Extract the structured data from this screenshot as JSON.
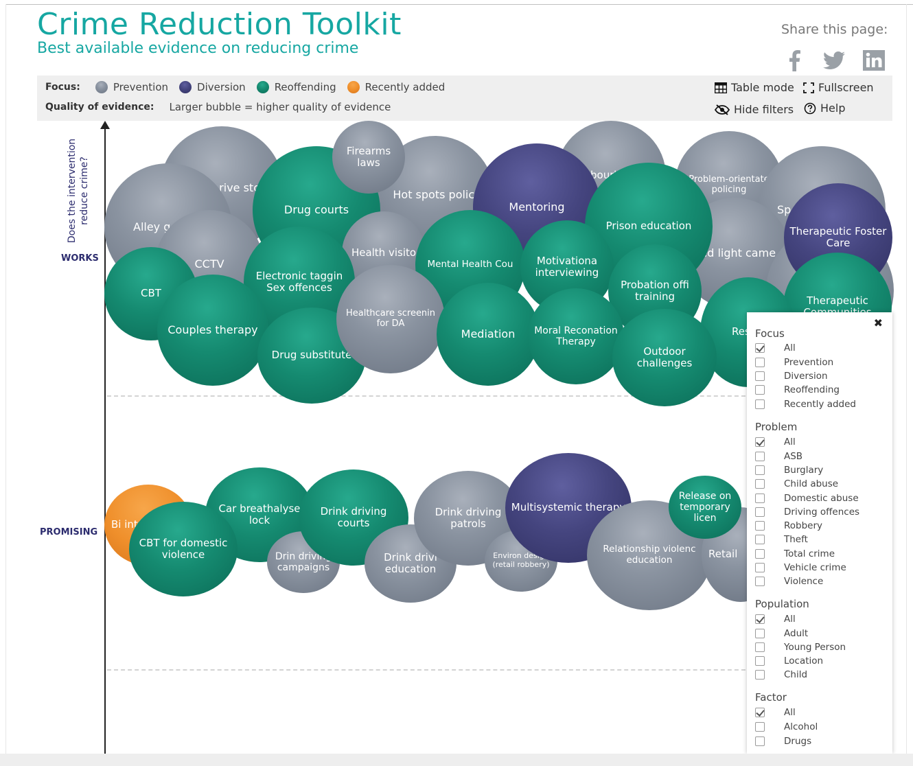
{
  "header": {
    "title": "Crime Reduction Toolkit",
    "subtitle": "Best available evidence on reducing crime",
    "share_label": "Share this page:",
    "share_icons": [
      "facebook-icon",
      "twitter-icon",
      "linkedin-icon"
    ]
  },
  "filterbar": {
    "focus_label": "Focus:",
    "legend": [
      {
        "label": "Prevention",
        "color": "#8a93a0"
      },
      {
        "label": "Diversion",
        "color": "#45457f"
      },
      {
        "label": "Reoffending",
        "color": "#158a70"
      },
      {
        "label": "Recently added",
        "color": "#ef8f2b"
      }
    ],
    "quality_label": "Quality of evidence:",
    "quality_text": "Larger bubble = higher quality of evidence",
    "tools": {
      "table_mode": "Table mode",
      "fullscreen": "Fullscreen",
      "hide_filters": "Hide filters",
      "help": "Help"
    }
  },
  "chart": {
    "y_question": "Does the intervention reduce crime?",
    "levels": {
      "works": "WORKS",
      "promising": "PROMISING"
    }
  },
  "bubbles": {
    "works": [
      "rive sto",
      "Alley g",
      "Firearms laws",
      "Drug courts",
      "Hot spots polici",
      "Mentoring",
      "Neighbourhood wat",
      "Problem-orientate policing",
      "Sp",
      "CCTV",
      "Health visito",
      "Prison education",
      "Therapeutic Foster Care",
      "Electronic taggin Sex offences",
      "Mental Health Cou",
      "Motivationa interviewing",
      "Red light came",
      "CBT",
      "Probation offi training",
      "Therapeutic Communities",
      "Healthcare screenin for DA",
      "Couples therapy",
      "Moral Reconation Therapy",
      "Mediation",
      "Restor",
      "Drug substitute",
      "Outdoor challenges"
    ],
    "promising": [
      "Bi inter fo",
      "Car breathalyse lock",
      "Drink driving courts",
      "Drink driving patrols",
      "Multisystemic therapy",
      "Release on temporary licen",
      "CBT for domestic violence",
      "Drin driving campaigns",
      "Drink drivi education",
      "Environ design (retail robbery)",
      "Relationship violenc education",
      "Retail"
    ]
  },
  "filter_panel": {
    "groups": [
      {
        "title": "Focus",
        "options": [
          {
            "label": "All",
            "checked": true
          },
          {
            "label": "Prevention",
            "checked": false
          },
          {
            "label": "Diversion",
            "checked": false
          },
          {
            "label": "Reoffending",
            "checked": false
          },
          {
            "label": "Recently added",
            "checked": false
          }
        ]
      },
      {
        "title": "Problem",
        "options": [
          {
            "label": "All",
            "checked": true
          },
          {
            "label": "ASB",
            "checked": false
          },
          {
            "label": "Burglary",
            "checked": false
          },
          {
            "label": "Child abuse",
            "checked": false
          },
          {
            "label": "Domestic abuse",
            "checked": false
          },
          {
            "label": "Driving offences",
            "checked": false
          },
          {
            "label": "Robbery",
            "checked": false
          },
          {
            "label": "Theft",
            "checked": false
          },
          {
            "label": "Total crime",
            "checked": false
          },
          {
            "label": "Vehicle crime",
            "checked": false
          },
          {
            "label": "Violence",
            "checked": false
          }
        ]
      },
      {
        "title": "Population",
        "options": [
          {
            "label": "All",
            "checked": true
          },
          {
            "label": "Adult",
            "checked": false
          },
          {
            "label": "Young Person",
            "checked": false
          },
          {
            "label": "Location",
            "checked": false
          },
          {
            "label": "Child",
            "checked": false
          }
        ]
      },
      {
        "title": "Factor",
        "options": [
          {
            "label": "All",
            "checked": true
          },
          {
            "label": "Alcohol",
            "checked": false
          },
          {
            "label": "Drugs",
            "checked": false
          }
        ]
      }
    ]
  }
}
